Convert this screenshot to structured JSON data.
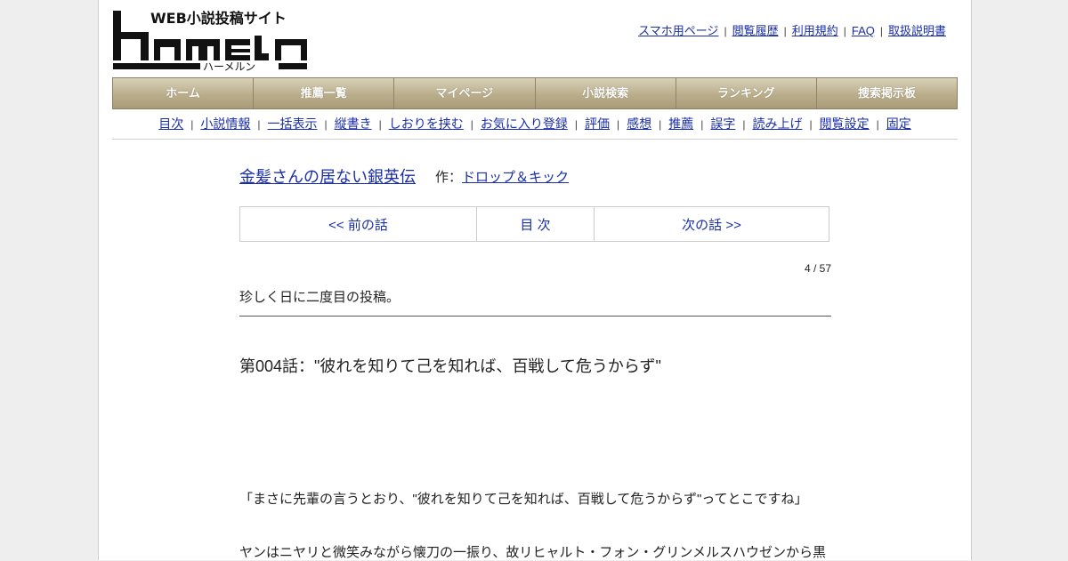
{
  "logo": {
    "tagline": "WEB小説投稿サイト",
    "wordmark": "HAMELN",
    "kana": "ハーメルン"
  },
  "top_links": [
    "スマホ用ページ",
    "閲覧履歴",
    "利用規約",
    "FAQ",
    "取扱説明書"
  ],
  "main_nav": [
    "ホーム",
    "推薦一覧",
    "マイページ",
    "小説検索",
    "ランキング",
    "捜索掲示板"
  ],
  "sub_nav": [
    "目次",
    "小説情報",
    "一括表示",
    "縦書き",
    "しおりを挟む",
    "お気に入り登録",
    "評価",
    "感想",
    "推薦",
    "誤字",
    "読み上げ",
    "閲覧設定",
    "固定"
  ],
  "novel": {
    "title": "金髪さんの居ない銀英伝",
    "author_prefix": "作：",
    "author": "ドロップ＆キック"
  },
  "chapter_nav": {
    "prev": "<< 前の話",
    "toc": "目 次",
    "next": "次の話 >>"
  },
  "counter": "4 / 57",
  "preface": "珍しく日に二度目の投稿。",
  "chapter_title": "第004話：\"彼れを知りて己を知れば、百戦して危うからず\"",
  "body": [
    "「まさに先輩の言うとおり、\"彼れを知りて己を知れば、百戦して危うからず\"ってとこですね」",
    "ヤンはニヤリと微笑みながら懐刀の一振り、故リヒャルト・フォン・グリンメルスハウゼンから黒"
  ]
}
